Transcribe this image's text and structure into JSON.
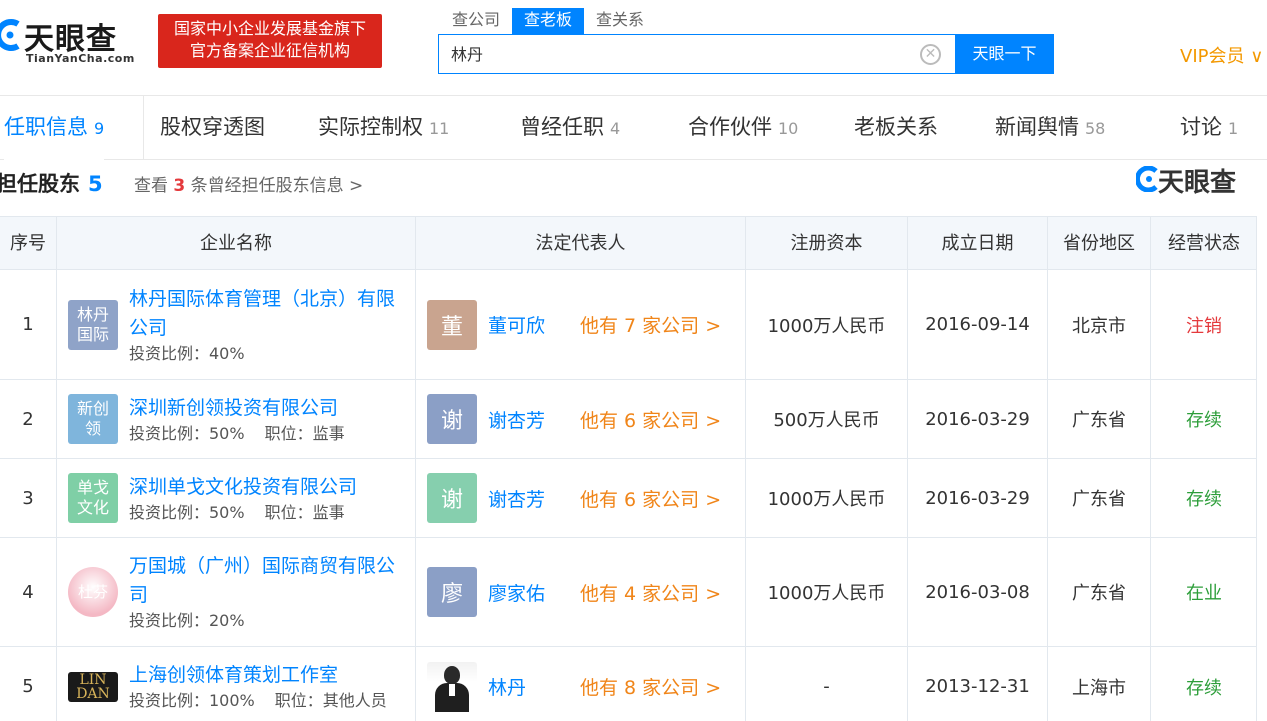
{
  "header": {
    "logo_text": "天眼查",
    "logo_url": "TianYanCha.com",
    "banner_line1": "国家中小企业发展基金旗下",
    "banner_line2": "官方备案企业征信机构",
    "search_tabs": [
      "查公司",
      "查老板",
      "查关系"
    ],
    "search_value": "林丹",
    "search_button": "天眼一下",
    "vip": "VIP会员 ∨"
  },
  "nav": [
    {
      "label": "任职信息",
      "count": "9"
    },
    {
      "label": "股权穿透图",
      "count": ""
    },
    {
      "label": "实际控制权",
      "count": "11"
    },
    {
      "label": "曾经任职",
      "count": "4"
    },
    {
      "label": "合作伙伴",
      "count": "10"
    },
    {
      "label": "老板关系",
      "count": ""
    },
    {
      "label": "新闻舆情",
      "count": "58"
    },
    {
      "label": "讨论",
      "count": "1"
    }
  ],
  "section": {
    "title": "担任股东",
    "count": "5",
    "history_prefix": "查看",
    "history_count": "3",
    "history_suffix": "条曾经担任股东信息 >",
    "watermark": "天眼查"
  },
  "table": {
    "headers": [
      "序号",
      "企业名称",
      "法定代表人",
      "注册资本",
      "成立日期",
      "省份地区",
      "经营状态"
    ],
    "rows": [
      {
        "index": "1",
        "logo_text": "林丹\n国际",
        "logo_color": "#8fa3c8",
        "company": "林丹国际体育管理（北京）有限公司",
        "ratio": "投资比例：40%",
        "position": "",
        "rep_avatar": "董",
        "rep_color": "#c9a48f",
        "rep": "董可欣",
        "rep_more": "他有 7 家公司 >",
        "capital": "1000万人民币",
        "date": "2016-09-14",
        "province": "北京市",
        "status": "注销",
        "status_color": "red"
      },
      {
        "index": "2",
        "logo_text": "新创\n领",
        "logo_color": "#7fb5dc",
        "company": "深圳新创领投资有限公司",
        "ratio": "投资比例：50%",
        "position": "职位：监事",
        "rep_avatar": "谢",
        "rep_color": "#8b9fc6",
        "rep": "谢杏芳",
        "rep_more": "他有 6 家公司 >",
        "capital": "500万人民币",
        "date": "2016-03-29",
        "province": "广东省",
        "status": "存续",
        "status_color": "green"
      },
      {
        "index": "3",
        "logo_text": "单戈\n文化",
        "logo_color": "#7fcfa6",
        "company": "深圳单戈文化投资有限公司",
        "ratio": "投资比例：50%",
        "position": "职位：监事",
        "rep_avatar": "谢",
        "rep_color": "#86cfae",
        "rep": "谢杏芳",
        "rep_more": "他有 6 家公司 >",
        "capital": "1000万人民币",
        "date": "2016-03-29",
        "province": "广东省",
        "status": "存续",
        "status_color": "green"
      },
      {
        "index": "4",
        "logo_text": "杜芬",
        "logo_color": "#f4b8c4",
        "company": "万国城（广州）国际商贸有限公司",
        "ratio": "投资比例：20%",
        "position": "",
        "rep_avatar": "廖",
        "rep_color": "#8b9fc6",
        "rep": "廖家佑",
        "rep_more": "他有 4 家公司 >",
        "capital": "1000万人民币",
        "date": "2016-03-08",
        "province": "广东省",
        "status": "在业",
        "status_color": "green"
      },
      {
        "index": "5",
        "logo_text": "LIN DAN",
        "logo_color": "#1a1a1a",
        "company": "上海创领体育策划工作室",
        "ratio": "投资比例：100%",
        "position": "职位：其他人员",
        "rep_avatar": "",
        "rep_color": "#ffffff",
        "rep": "林丹",
        "rep_more": "他有 8 家公司 >",
        "capital": "-",
        "date": "2013-12-31",
        "province": "上海市",
        "status": "存续",
        "status_color": "green"
      }
    ]
  },
  "colors": {
    "accent": "#0084ff",
    "banner_red": "#d9261c",
    "orange": "#f08519",
    "status_green": "#2d9e3a",
    "status_red": "#e4393c"
  }
}
